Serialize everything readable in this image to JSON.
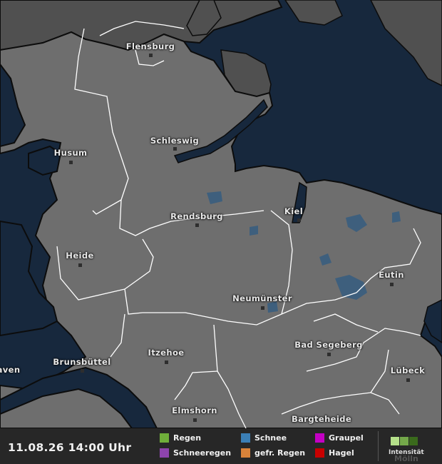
{
  "map": {
    "colors": {
      "sea": "#17283d",
      "land": "#6e6e6e",
      "land_dark": "#505050",
      "border": "#ffffff",
      "lake": "#3e5f7d",
      "coast": "#0c0c0c"
    },
    "cities": [
      {
        "name": "Flensburg",
        "id": "flensburg"
      },
      {
        "name": "Schleswig",
        "id": "schleswig"
      },
      {
        "name": "Husum",
        "id": "husum"
      },
      {
        "name": "Rendsburg",
        "id": "rendsburg"
      },
      {
        "name": "Kiel",
        "id": "kiel"
      },
      {
        "name": "Heide",
        "id": "heide"
      },
      {
        "name": "Eutin",
        "id": "eutin"
      },
      {
        "name": "Neumünster",
        "id": "neumuenster"
      },
      {
        "name": "Bad Segeberg",
        "id": "bad-segeberg"
      },
      {
        "name": "Itzehoe",
        "id": "itzehoe"
      },
      {
        "name": "Brunsbüttel",
        "id": "brunsbuettel"
      },
      {
        "name": "Lübeck",
        "id": "luebeck"
      },
      {
        "name": "aven",
        "id": "aven"
      },
      {
        "name": "Elmshorn",
        "id": "elmshorn"
      },
      {
        "name": "Bargteheide",
        "id": "bargteheide"
      }
    ]
  },
  "legend": {
    "timestamp": "11.08.26 14:00 Uhr",
    "items": [
      {
        "label": "Regen",
        "color": "#6fae3a",
        "icon": "rain-swatch"
      },
      {
        "label": "Schnee",
        "color": "#3b7fb6",
        "icon": "snow-swatch"
      },
      {
        "label": "Graupel",
        "color": "#c400c4",
        "icon": "graupel-swatch"
      },
      {
        "label": "Schneeregen",
        "color": "#8e44ad",
        "icon": "sleet-swatch"
      },
      {
        "label": "gefr. Regen",
        "color": "#d9833a",
        "icon": "freezing-rain-swatch"
      },
      {
        "label": "Hagel",
        "color": "#c80000",
        "icon": "hail-swatch"
      }
    ],
    "intensity": {
      "label": "Intensität",
      "colors": [
        "#b5e08a",
        "#74a84a",
        "#3a6a1c"
      ]
    },
    "ghost_label": "Mölln"
  }
}
